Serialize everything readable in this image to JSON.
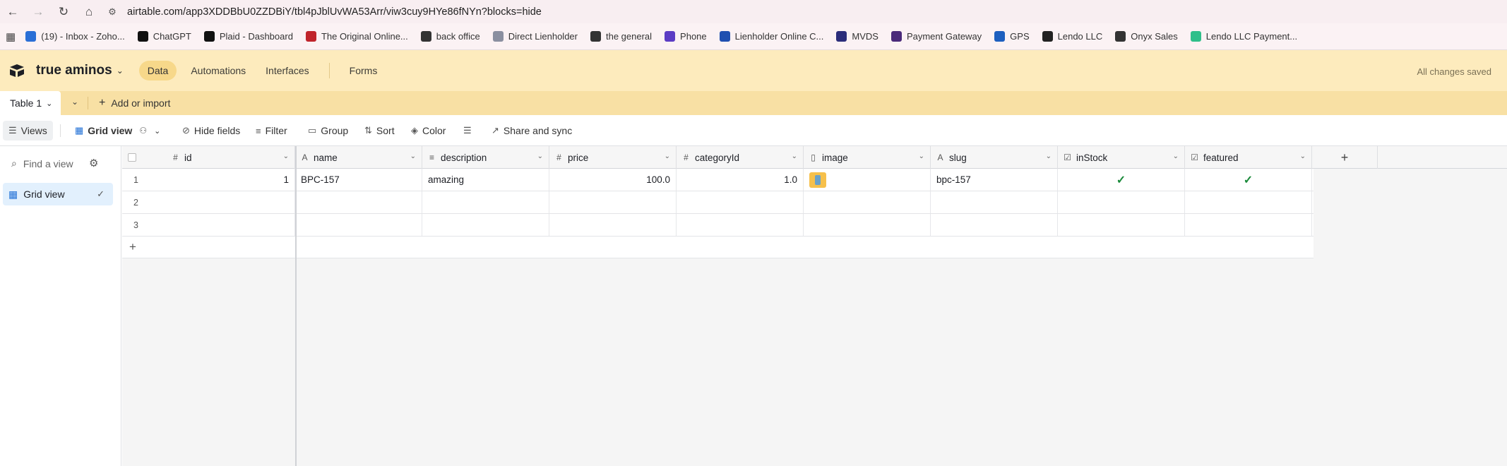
{
  "browser": {
    "url": "airtable.com/app3XDDBbU0ZZDBiY/tbl4pJblUvWA53Arr/viw3cuy9HYe86fNYn?blocks=hide",
    "bookmarks": [
      {
        "label": "(19) - Inbox - Zoho...",
        "color": "#2a6fd6"
      },
      {
        "label": "ChatGPT",
        "color": "#111111"
      },
      {
        "label": "Plaid - Dashboard",
        "color": "#111111"
      },
      {
        "label": "The Original Online...",
        "color": "#c0242b"
      },
      {
        "label": "back office",
        "color": "#333333"
      },
      {
        "label": "Direct Lienholder",
        "color": "#8a8fa0"
      },
      {
        "label": "the general",
        "color": "#333333"
      },
      {
        "label": "Phone",
        "color": "#5b3cc4"
      },
      {
        "label": "Lienholder Online C...",
        "color": "#1f4fb0"
      },
      {
        "label": "MVDS",
        "color": "#2b2d7a"
      },
      {
        "label": "Payment Gateway",
        "color": "#4a2a7a"
      },
      {
        "label": "GPS",
        "color": "#1d5fbf"
      },
      {
        "label": "Lendo LLC",
        "color": "#222222"
      },
      {
        "label": "Onyx Sales",
        "color": "#333333"
      },
      {
        "label": "Lendo LLC Payment...",
        "color": "#2fbf8a"
      }
    ]
  },
  "header": {
    "base_name": "true aminos",
    "tabs": [
      "Data",
      "Automations",
      "Interfaces",
      "Forms"
    ],
    "status": "All changes saved"
  },
  "tablebar": {
    "table_name": "Table 1",
    "add_label": "Add or import"
  },
  "toolbar": {
    "views": "Views",
    "grid_view": "Grid view",
    "hide_fields": "Hide fields",
    "filter": "Filter",
    "group": "Group",
    "sort": "Sort",
    "color": "Color",
    "share": "Share and sync"
  },
  "sidebar": {
    "find_placeholder": "Find a view",
    "views": [
      "Grid view"
    ]
  },
  "grid": {
    "columns": [
      {
        "name": "id",
        "type_icon": "#"
      },
      {
        "name": "name",
        "type_icon": "A"
      },
      {
        "name": "description",
        "type_icon": "≡"
      },
      {
        "name": "price",
        "type_icon": "#"
      },
      {
        "name": "categoryId",
        "type_icon": "#"
      },
      {
        "name": "image",
        "type_icon": "▯"
      },
      {
        "name": "slug",
        "type_icon": "A"
      },
      {
        "name": "inStock",
        "type_icon": "☑"
      },
      {
        "name": "featured",
        "type_icon": "☑"
      }
    ],
    "rows": [
      {
        "num": "1",
        "id": "1",
        "name": "BPC-157",
        "description": "amazing",
        "price": "100.0",
        "categoryId": "1.0",
        "image": true,
        "slug": "bpc-157",
        "inStock": true,
        "featured": true
      },
      {
        "num": "2",
        "id": "",
        "name": "",
        "description": "",
        "price": "",
        "categoryId": "",
        "image": false,
        "slug": "",
        "inStock": false,
        "featured": false
      },
      {
        "num": "3",
        "id": "",
        "name": "",
        "description": "",
        "price": "",
        "categoryId": "",
        "image": false,
        "slug": "",
        "inStock": false,
        "featured": false
      }
    ]
  }
}
